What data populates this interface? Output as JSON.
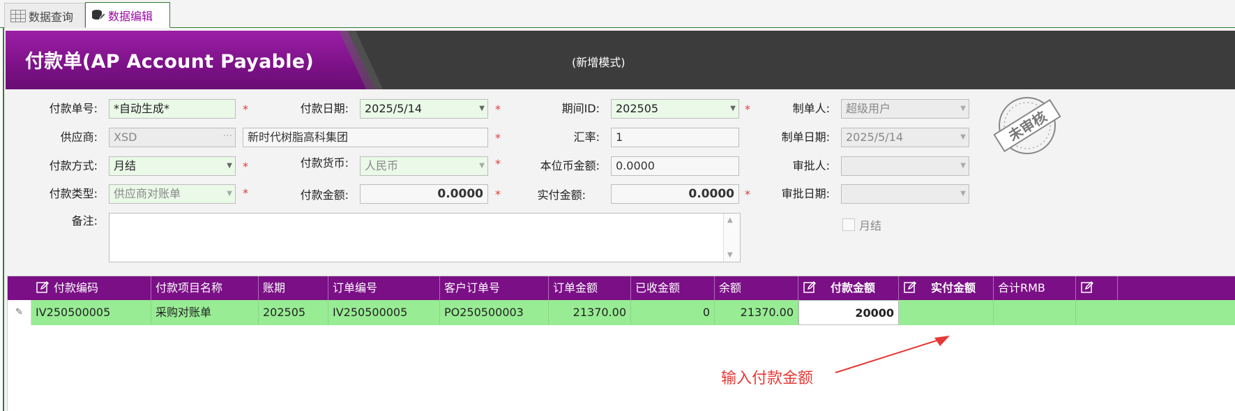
{
  "tabs": [
    {
      "label": "数据查询",
      "icon": "grid-icon"
    },
    {
      "label": "数据编辑",
      "icon": "database-edit-icon"
    }
  ],
  "header": {
    "title": "付款单(AP Account Payable)",
    "mode": "(新增模式)"
  },
  "form": {
    "doc_no": {
      "label": "付款单号:",
      "value": "*自动生成*"
    },
    "pay_date": {
      "label": "付款日期:",
      "value": "2025/5/14"
    },
    "period": {
      "label": "期间ID:",
      "value": "202505"
    },
    "creator": {
      "label": "制单人:",
      "value": "超级用户"
    },
    "supplier": {
      "label": "供应商:",
      "code": "XSD",
      "name": "新时代树脂高科集团"
    },
    "rate": {
      "label": "汇率:",
      "value": "1"
    },
    "create_date": {
      "label": "制单日期:",
      "value": "2025/5/14"
    },
    "pay_method": {
      "label": "付款方式:",
      "value": "月结"
    },
    "currency": {
      "label": "付款货币:",
      "value": "人民币"
    },
    "local_amount": {
      "label": "本位币金额:",
      "value": "0.0000"
    },
    "approver": {
      "label": "审批人:",
      "value": ""
    },
    "pay_type": {
      "label": "付款类型:",
      "value": "供应商对账单"
    },
    "pay_amount": {
      "label": "付款金额:",
      "value": "0.0000"
    },
    "actual_amount": {
      "label": "实付金额:",
      "value": "0.0000"
    },
    "approve_date": {
      "label": "审批日期:",
      "value": ""
    },
    "memo": {
      "label": "备注:",
      "value": ""
    },
    "monthly_checkbox": {
      "label": "月结",
      "checked": false
    },
    "required_mark": "*"
  },
  "stamp": {
    "text": "未审核"
  },
  "table": {
    "columns": [
      "付款编码",
      "付款项目名称",
      "账期",
      "订单编号",
      "客户订单号",
      "订单金额",
      "已收金额",
      "余额",
      "付款金额",
      "实付金额",
      "合计RMB"
    ],
    "rows": [
      [
        "IV250500005",
        "采购对账单",
        "202505",
        "IV250500005",
        "PO250500003",
        "21370.00",
        "0",
        "21370.00",
        "20000",
        "",
        ""
      ]
    ]
  },
  "annotation": {
    "text": "输入付款金额",
    "color": "#e53935"
  },
  "colors": {
    "accent": "#7a0f86",
    "row": "#98ec94",
    "tab_active": "#9b0aa3"
  }
}
